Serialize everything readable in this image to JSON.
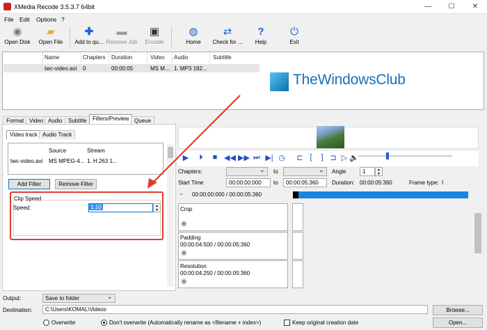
{
  "window": {
    "title": "XMedia Recode 3.5.3.7 64bit",
    "min": "—",
    "max": "☐",
    "close": "✕"
  },
  "menu": [
    "File",
    "Edit",
    "Options",
    "?"
  ],
  "toolbar": [
    {
      "label": "Open Disk",
      "icon": "disc-icon",
      "glyph": "💿"
    },
    {
      "label": "Open File",
      "icon": "folder-icon",
      "glyph": "📂"
    },
    {
      "label": "Add to qu...",
      "icon": "plus-icon",
      "glyph": "✚"
    },
    {
      "label": "Remove Job",
      "icon": "minus-icon",
      "glyph": "━"
    },
    {
      "label": "Encode",
      "icon": "encode-icon",
      "glyph": "🎬"
    },
    {
      "label": "Home",
      "icon": "globe-icon",
      "glyph": "🌐"
    },
    {
      "label": "Check for ...",
      "icon": "check-update-icon",
      "glyph": "⇄"
    },
    {
      "label": "Help",
      "icon": "help-icon",
      "glyph": "?"
    },
    {
      "label": "Exit",
      "icon": "power-icon",
      "glyph": "⏻"
    }
  ],
  "filelist": {
    "headers": [
      "Name",
      "Chapters",
      "Duration",
      "Video",
      "Audio",
      "Subtitle"
    ],
    "row": [
      "twc-video.avi",
      "0",
      "00:00:05",
      "MS M...",
      "1. MP3 192...",
      ""
    ]
  },
  "watermark": "TheWindowsClub",
  "tabs": [
    "Format",
    "Video",
    "Audio",
    "Subtitle",
    "Filters/Preview",
    "Queue"
  ],
  "inner_tabs": [
    "Video track",
    "Audio Track"
  ],
  "stream": {
    "headers": [
      "Source",
      "Stream"
    ],
    "row": [
      "twc-video.avi",
      "MS MPEG-4...",
      "1. H.263 1..."
    ]
  },
  "buttons": {
    "add_filter": "Add Filter",
    "remove_filter": "Remove Filter"
  },
  "clip": {
    "group": "Clip Speed",
    "label": "Speed:",
    "value": "1.10"
  },
  "player": {
    "chapters": "Chapters:",
    "to": "to",
    "angle": "Angle",
    "angle_value": "1",
    "start_time": "Start Time",
    "start_value": "00:00:00:000",
    "end_value": "00:00:05:360",
    "duration_label": "Duration:",
    "duration_value": "00:00:05:360",
    "frame_type_label": "Frame type:",
    "frame_type_value": "I",
    "range": "00:00:00:000 / 00:00:05:360"
  },
  "filters": [
    {
      "name": "Crop",
      "time": ""
    },
    {
      "name": "Padding",
      "time": "00:00:04:500 / 00:00:05:360"
    },
    {
      "name": "Resolution",
      "time": "00:00:04:250 / 00:00:05:360"
    }
  ],
  "bottom": {
    "output_label": "Output:",
    "output_value": "Save to folder",
    "destination_label": "Destination:",
    "destination_value": "C:\\Users\\KOMAL\\Videos",
    "browse": "Browse...",
    "open": "Open...",
    "overwrite": "Overwrite",
    "dont_overwrite": "Don't overwrite (Automatically rename as <filename + index>)",
    "keep_date": "Keep original creation date"
  },
  "colors": {
    "highlight": "#e03b2c",
    "accent": "#1c84e0"
  }
}
